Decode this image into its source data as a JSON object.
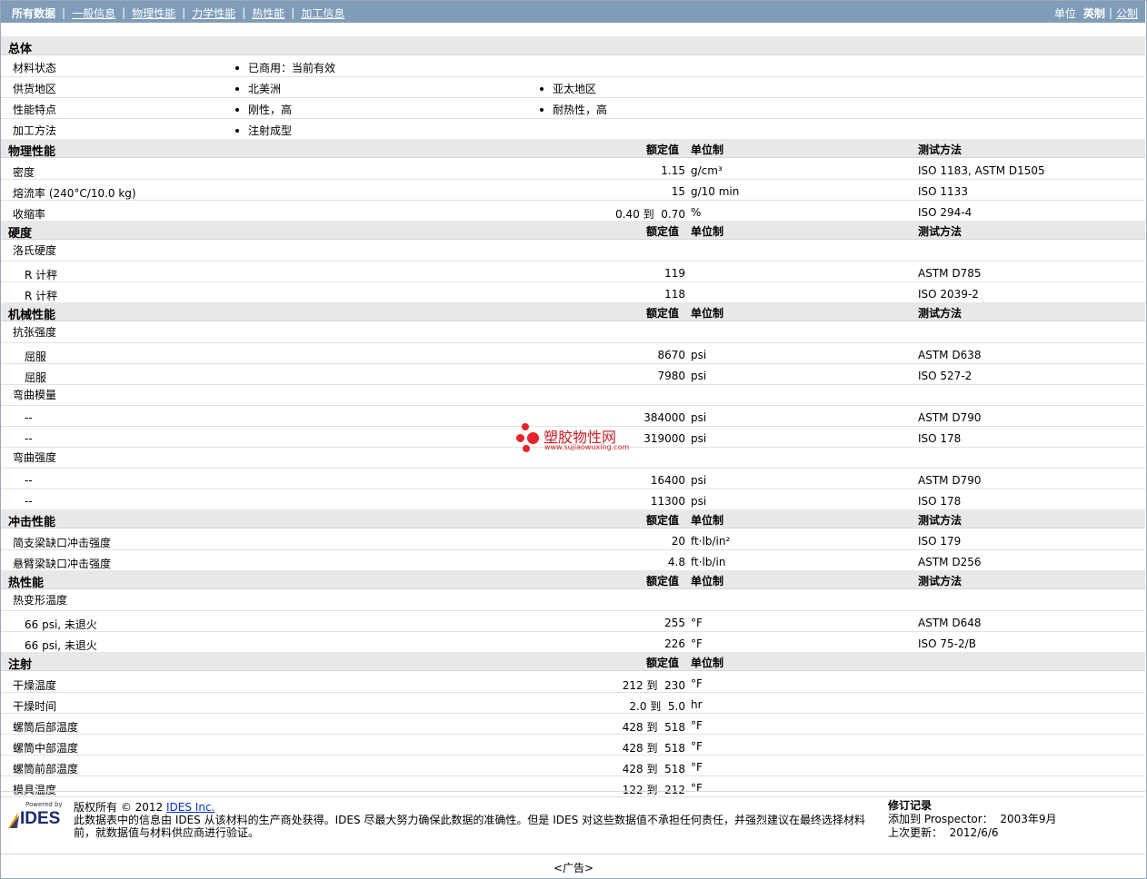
{
  "nav": {
    "tabs": [
      "所有数据",
      "一般信息",
      "物理性能",
      "力学性能",
      "热性能",
      "加工信息"
    ],
    "units_label": "单位",
    "unit_english": "英制",
    "unit_metric": "公制"
  },
  "sections": {
    "general": {
      "title": "总体",
      "rows": [
        {
          "label": "材料状态",
          "items": [
            "已商用：当前有效"
          ]
        },
        {
          "label": "供货地区",
          "items": [
            "北美洲",
            "亚太地区"
          ]
        },
        {
          "label": "性能特点",
          "items": [
            "刚性，高",
            "耐热性，高"
          ]
        },
        {
          "label": "加工方法",
          "items": [
            "注射成型"
          ]
        }
      ]
    },
    "headers": {
      "nominal": "额定值",
      "unit": "单位制",
      "test": "测试方法"
    },
    "physical": {
      "title": "物理性能",
      "rows": [
        {
          "label": "密度",
          "value": "1.15",
          "unit": "g/cm³",
          "test": "ISO 1183, ASTM D1505"
        },
        {
          "label": "熔流率 (240°C/10.0 kg)",
          "value": "15",
          "unit": "g/10 min",
          "test": "ISO 1133"
        },
        {
          "label": "收缩率",
          "value": "0.40 到  0.70",
          "unit": "%",
          "test": "ISO 294-4"
        }
      ]
    },
    "hardness": {
      "title": "硬度",
      "rows": [
        {
          "label": "洛氏硬度",
          "value": "",
          "unit": "",
          "test": ""
        },
        {
          "label": "R 计秤",
          "value": "119",
          "unit": "",
          "test": "ASTM D785"
        },
        {
          "label": "R 计秤",
          "value": "118",
          "unit": "",
          "test": "ISO 2039-2"
        }
      ]
    },
    "mechanical": {
      "title": "机械性能",
      "rows": [
        {
          "label": "抗张强度",
          "value": "",
          "unit": "",
          "test": ""
        },
        {
          "label": "屈服",
          "value": "8670",
          "unit": "psi",
          "test": "ASTM D638"
        },
        {
          "label": "屈服",
          "value": "7980",
          "unit": "psi",
          "test": "ISO 527-2"
        },
        {
          "label": "弯曲模量",
          "value": "",
          "unit": "",
          "test": ""
        },
        {
          "label": "--",
          "value": "384000",
          "unit": "psi",
          "test": "ASTM D790"
        },
        {
          "label": "--",
          "value": "319000",
          "unit": "psi",
          "test": "ISO 178"
        },
        {
          "label": "弯曲强度",
          "value": "",
          "unit": "",
          "test": ""
        },
        {
          "label": "--",
          "value": "16400",
          "unit": "psi",
          "test": "ASTM D790"
        },
        {
          "label": "--",
          "value": "11300",
          "unit": "psi",
          "test": "ISO 178"
        }
      ]
    },
    "impact": {
      "title": "冲击性能",
      "rows": [
        {
          "label": "简支梁缺口冲击强度",
          "value": "20",
          "unit": "ft·lb/in²",
          "test": "ISO 179"
        },
        {
          "label": "悬臂梁缺口冲击强度",
          "value": "4.8",
          "unit": "ft·lb/in",
          "test": "ASTM D256"
        }
      ]
    },
    "thermal": {
      "title": "热性能",
      "rows": [
        {
          "label": "热变形温度",
          "value": "",
          "unit": "",
          "test": ""
        },
        {
          "label": "66 psi, 未退火",
          "value": "255",
          "unit": "°F",
          "test": "ASTM D648"
        },
        {
          "label": "66 psi, 未退火",
          "value": "226",
          "unit": "°F",
          "test": "ISO 75-2/B"
        }
      ]
    },
    "injection": {
      "title": "注射",
      "rows": [
        {
          "label": "干燥温度",
          "value": "212 到  230",
          "unit": "°F",
          "test": ""
        },
        {
          "label": "干燥时间",
          "value": "2.0 到  5.0",
          "unit": "hr",
          "test": ""
        },
        {
          "label": "螺筒后部温度",
          "value": "428 到  518",
          "unit": "°F",
          "test": ""
        },
        {
          "label": "螺筒中部温度",
          "value": "428 到  518",
          "unit": "°F",
          "test": ""
        },
        {
          "label": "螺筒前部温度",
          "value": "428 到  518",
          "unit": "°F",
          "test": ""
        },
        {
          "label": "模具温度",
          "value": "122 到  212",
          "unit": "°F",
          "test": ""
        }
      ]
    }
  },
  "watermark": {
    "title": "塑胶物性网",
    "url": "www.sujiaowuxing.com"
  },
  "footer": {
    "logo_powered": "Powered by",
    "logo_name": "IDES",
    "copyright_prefix": "版权所有  © 2012",
    "copyright_link": "IDES Inc.",
    "disclaimer": "此数据表中的信息由  IDES 从该材料的生产商处获得。IDES 尽最大努力确保此数据的准确性。但是  IDES 对这些数据值不承担任何责任，并强烈建议在最终选择材料前，就数据值与材料供应商进行验证。",
    "revision_title": "修订记录",
    "added_label": "添加到  Prospector：",
    "added_value": "2003年9月",
    "updated_label": "上次更新：",
    "updated_value": "2012/6/6"
  },
  "ad_label": "<广告>",
  "colors": {
    "nav_bg": "#7f9db9",
    "section_bg": "#e8e8e8",
    "watermark": "#c8202a"
  }
}
